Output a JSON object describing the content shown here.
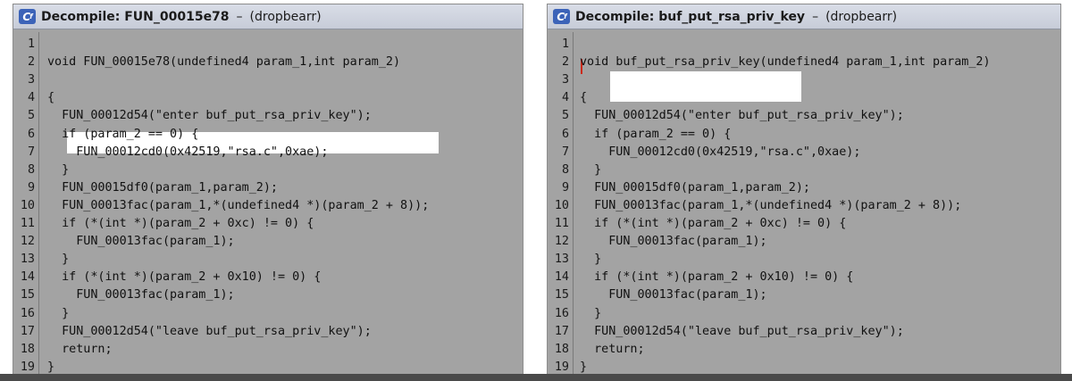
{
  "panels": [
    {
      "title": "Decompile: FUN_00015e78",
      "dash": "–",
      "program": "(dropbearr)",
      "lines": [
        {
          "n": "1",
          "t": ""
        },
        {
          "n": "2",
          "t": "void FUN_00015e78(undefined4 param_1,int param_2)"
        },
        {
          "n": "3",
          "t": ""
        },
        {
          "n": "4",
          "t": "{"
        },
        {
          "n": "5",
          "t": "  FUN_00012d54(\"enter buf_put_rsa_priv_key\");"
        },
        {
          "n": "6",
          "t": "  if (param_2 == 0) {"
        },
        {
          "n": "7",
          "t": "    FUN_00012cd0(0x42519,\"rsa.c\",0xae);"
        },
        {
          "n": "8",
          "t": "  }"
        },
        {
          "n": "9",
          "t": "  FUN_00015df0(param_1,param_2);"
        },
        {
          "n": "10",
          "t": "  FUN_00013fac(param_1,*(undefined4 *)(param_2 + 8));"
        },
        {
          "n": "11",
          "t": "  if (*(int *)(param_2 + 0xc) != 0) {"
        },
        {
          "n": "12",
          "t": "    FUN_00013fac(param_1);"
        },
        {
          "n": "13",
          "t": "  }"
        },
        {
          "n": "14",
          "t": "  if (*(int *)(param_2 + 0x10) != 0) {"
        },
        {
          "n": "15",
          "t": "    FUN_00013fac(param_1);"
        },
        {
          "n": "16",
          "t": "  }"
        },
        {
          "n": "17",
          "t": "  FUN_00012d54(\"leave buf_put_rsa_priv_key\");"
        },
        {
          "n": "18",
          "t": "  return;"
        },
        {
          "n": "19",
          "t": "}"
        }
      ]
    },
    {
      "title": "Decompile: buf_put_rsa_priv_key",
      "dash": "–",
      "program": "(dropbearr)",
      "lines": [
        {
          "n": "1",
          "t": ""
        },
        {
          "n": "2",
          "t": "void buf_put_rsa_priv_key(undefined4 param_1,int param_2)"
        },
        {
          "n": "3",
          "t": ""
        },
        {
          "n": "4",
          "t": "{"
        },
        {
          "n": "5",
          "t": "  FUN_00012d54(\"enter buf_put_rsa_priv_key\");"
        },
        {
          "n": "6",
          "t": "  if (param_2 == 0) {"
        },
        {
          "n": "7",
          "t": "    FUN_00012cd0(0x42519,\"rsa.c\",0xae);"
        },
        {
          "n": "8",
          "t": "  }"
        },
        {
          "n": "9",
          "t": "  FUN_00015df0(param_1,param_2);"
        },
        {
          "n": "10",
          "t": "  FUN_00013fac(param_1,*(undefined4 *)(param_2 + 8));"
        },
        {
          "n": "11",
          "t": "  if (*(int *)(param_2 + 0xc) != 0) {"
        },
        {
          "n": "12",
          "t": "    FUN_00013fac(param_1);"
        },
        {
          "n": "13",
          "t": "  }"
        },
        {
          "n": "14",
          "t": "  if (*(int *)(param_2 + 0x10) != 0) {"
        },
        {
          "n": "15",
          "t": "    FUN_00013fac(param_1);"
        },
        {
          "n": "16",
          "t": "  }"
        },
        {
          "n": "17",
          "t": "  FUN_00012d54(\"leave buf_put_rsa_priv_key\");"
        },
        {
          "n": "18",
          "t": "  return;"
        },
        {
          "n": "19",
          "t": "}"
        }
      ]
    }
  ],
  "icon": "ghidra-decompiler-icon",
  "colors": {
    "code_background": "#a3a3a3",
    "highlight": "#ffffff",
    "cursor": "#cc2a1a",
    "keyword": "#1e2896",
    "variable": "#6b2a6b"
  }
}
